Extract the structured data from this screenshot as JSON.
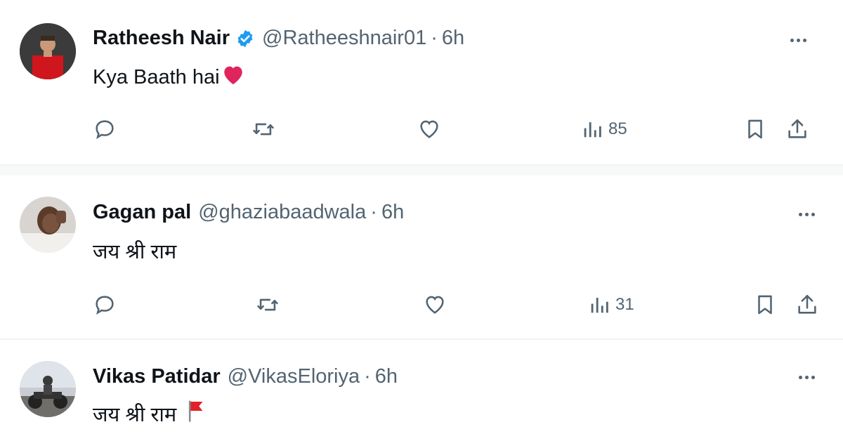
{
  "tweets": [
    {
      "name": "Ratheesh Nair",
      "handle": "@Ratheeshnair01",
      "separator": "·",
      "time": "6h",
      "verified": true,
      "text": "Kya Baath hai",
      "emoji": "red-heart",
      "views": "85",
      "avatar": "avatar-red-jersey-player"
    },
    {
      "name": "Gagan pal",
      "handle": "@ghaziabaadwala",
      "separator": "·",
      "time": "6h",
      "verified": false,
      "text": "जय श्री राम",
      "views": "31",
      "avatar": "avatar-person-photo"
    },
    {
      "name": "Vikas Patidar",
      "handle": "@VikasEloriya",
      "separator": "·",
      "time": "6h",
      "verified": false,
      "text": "जय श्री राम",
      "emoji": "red-flag",
      "avatar": "avatar-motorbike-photo"
    }
  ],
  "colors": {
    "text_primary": "#0f1419",
    "text_secondary": "#536471",
    "verified_blue": "#1d9bf0",
    "heart_red": "#e0245e",
    "divider": "#eff3f4"
  }
}
